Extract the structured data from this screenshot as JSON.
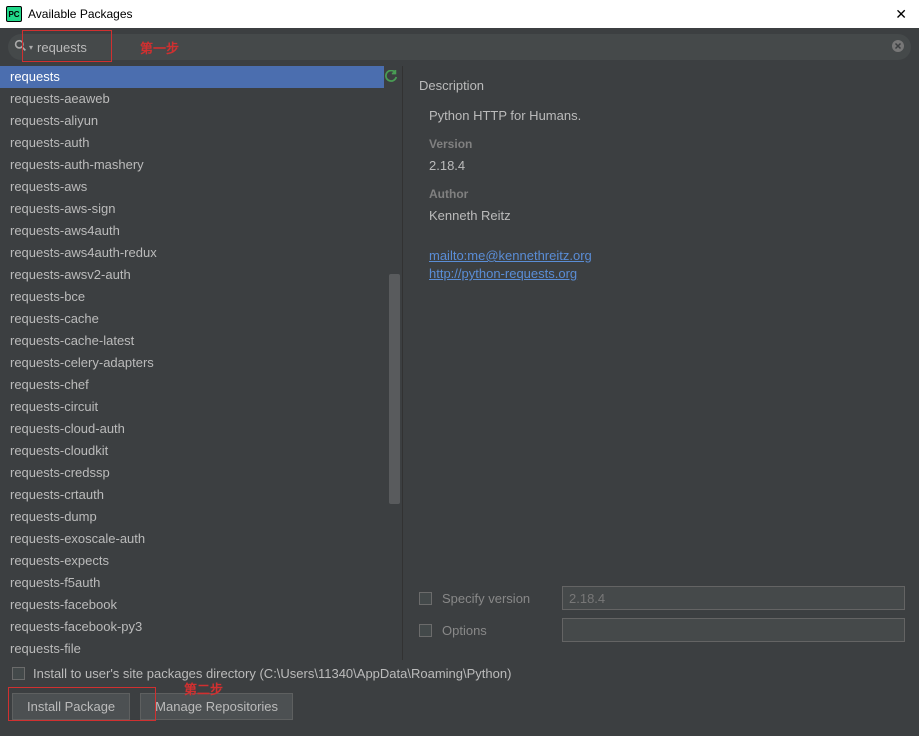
{
  "window": {
    "title": "Available Packages"
  },
  "annotations": {
    "step1": "第一步",
    "step2": "第二步"
  },
  "search": {
    "value": "requests"
  },
  "packages": {
    "items": [
      "requests",
      "requests-aeaweb",
      "requests-aliyun",
      "requests-auth",
      "requests-auth-mashery",
      "requests-aws",
      "requests-aws-sign",
      "requests-aws4auth",
      "requests-aws4auth-redux",
      "requests-awsv2-auth",
      "requests-bce",
      "requests-cache",
      "requests-cache-latest",
      "requests-celery-adapters",
      "requests-chef",
      "requests-circuit",
      "requests-cloud-auth",
      "requests-cloudkit",
      "requests-credssp",
      "requests-crtauth",
      "requests-dump",
      "requests-exoscale-auth",
      "requests-expects",
      "requests-f5auth",
      "requests-facebook",
      "requests-facebook-py3",
      "requests-file"
    ],
    "selectedIndex": 0
  },
  "details": {
    "headingDescription": "Description",
    "description": "Python HTTP for Humans.",
    "labelVersion": "Version",
    "version": "2.18.4",
    "labelAuthor": "Author",
    "author": "Kenneth Reitz",
    "links": [
      "mailto:me@kennethreitz.org",
      "http://python-requests.org"
    ]
  },
  "options": {
    "specifyVersionLabel": "Specify version",
    "specifyVersionValue": "2.18.4",
    "optionsLabel": "Options",
    "optionsValue": ""
  },
  "bottom": {
    "installToUserSite": "Install to user's site packages directory (C:\\Users\\11340\\AppData\\Roaming\\Python)",
    "installPackage": "Install Package",
    "manageRepositories": "Manage Repositories"
  }
}
